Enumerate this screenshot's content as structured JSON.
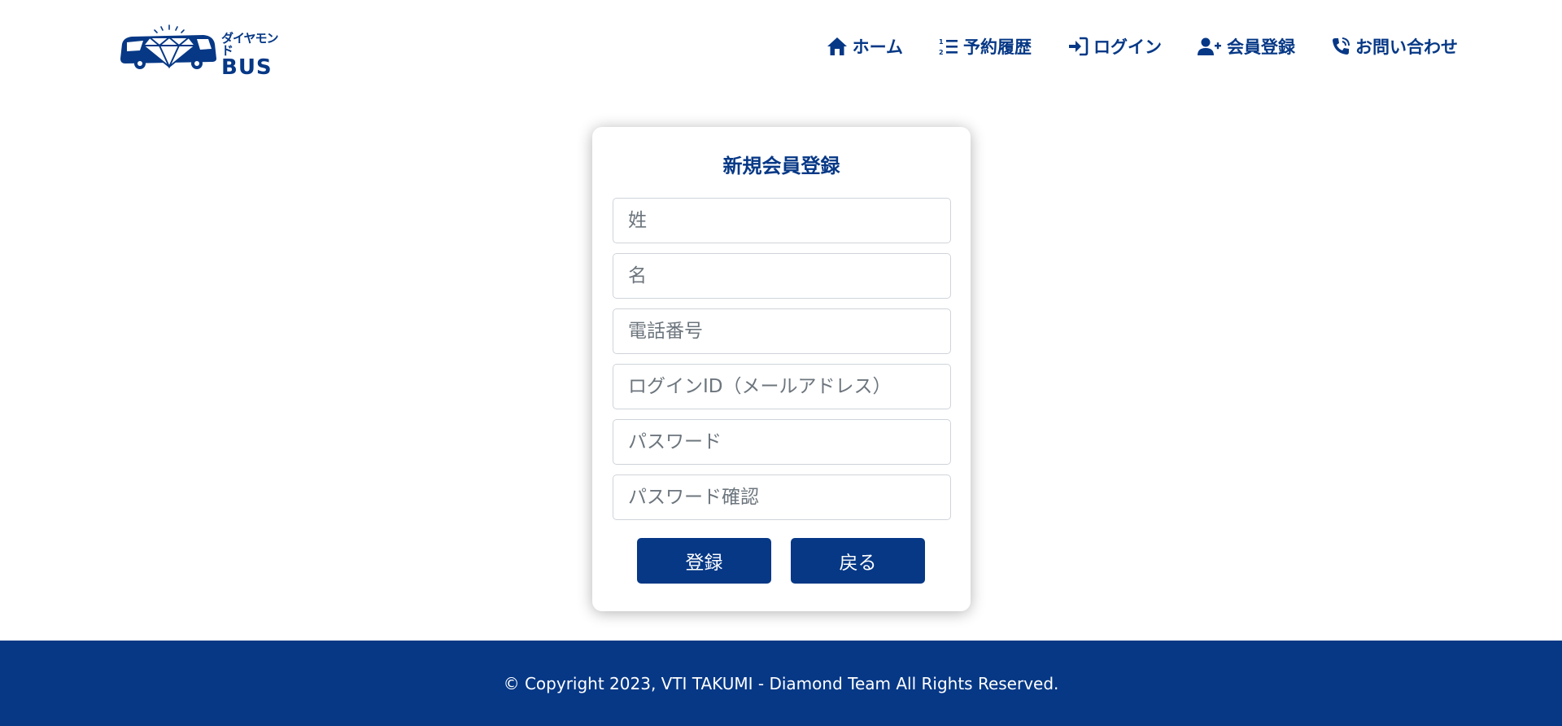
{
  "brand": {
    "kana": "ダイヤモンド",
    "name": "BUS",
    "color": "#063886"
  },
  "nav": {
    "home": "ホーム",
    "history": "予約履歴",
    "login": "ログイン",
    "register": "会員登録",
    "contact": "お問い合わせ"
  },
  "form": {
    "title": "新規会員登録",
    "last_name_placeholder": "姓",
    "first_name_placeholder": "名",
    "phone_placeholder": "電話番号",
    "login_id_placeholder": "ログインID（メールアドレス）",
    "password_placeholder": "パスワード",
    "password_confirm_placeholder": "パスワード確認",
    "submit_label": "登録",
    "back_label": "戻る"
  },
  "footer": {
    "copyright": "© Copyright 2023, VTI TAKUMI - Diamond Team All Rights Reserved."
  }
}
